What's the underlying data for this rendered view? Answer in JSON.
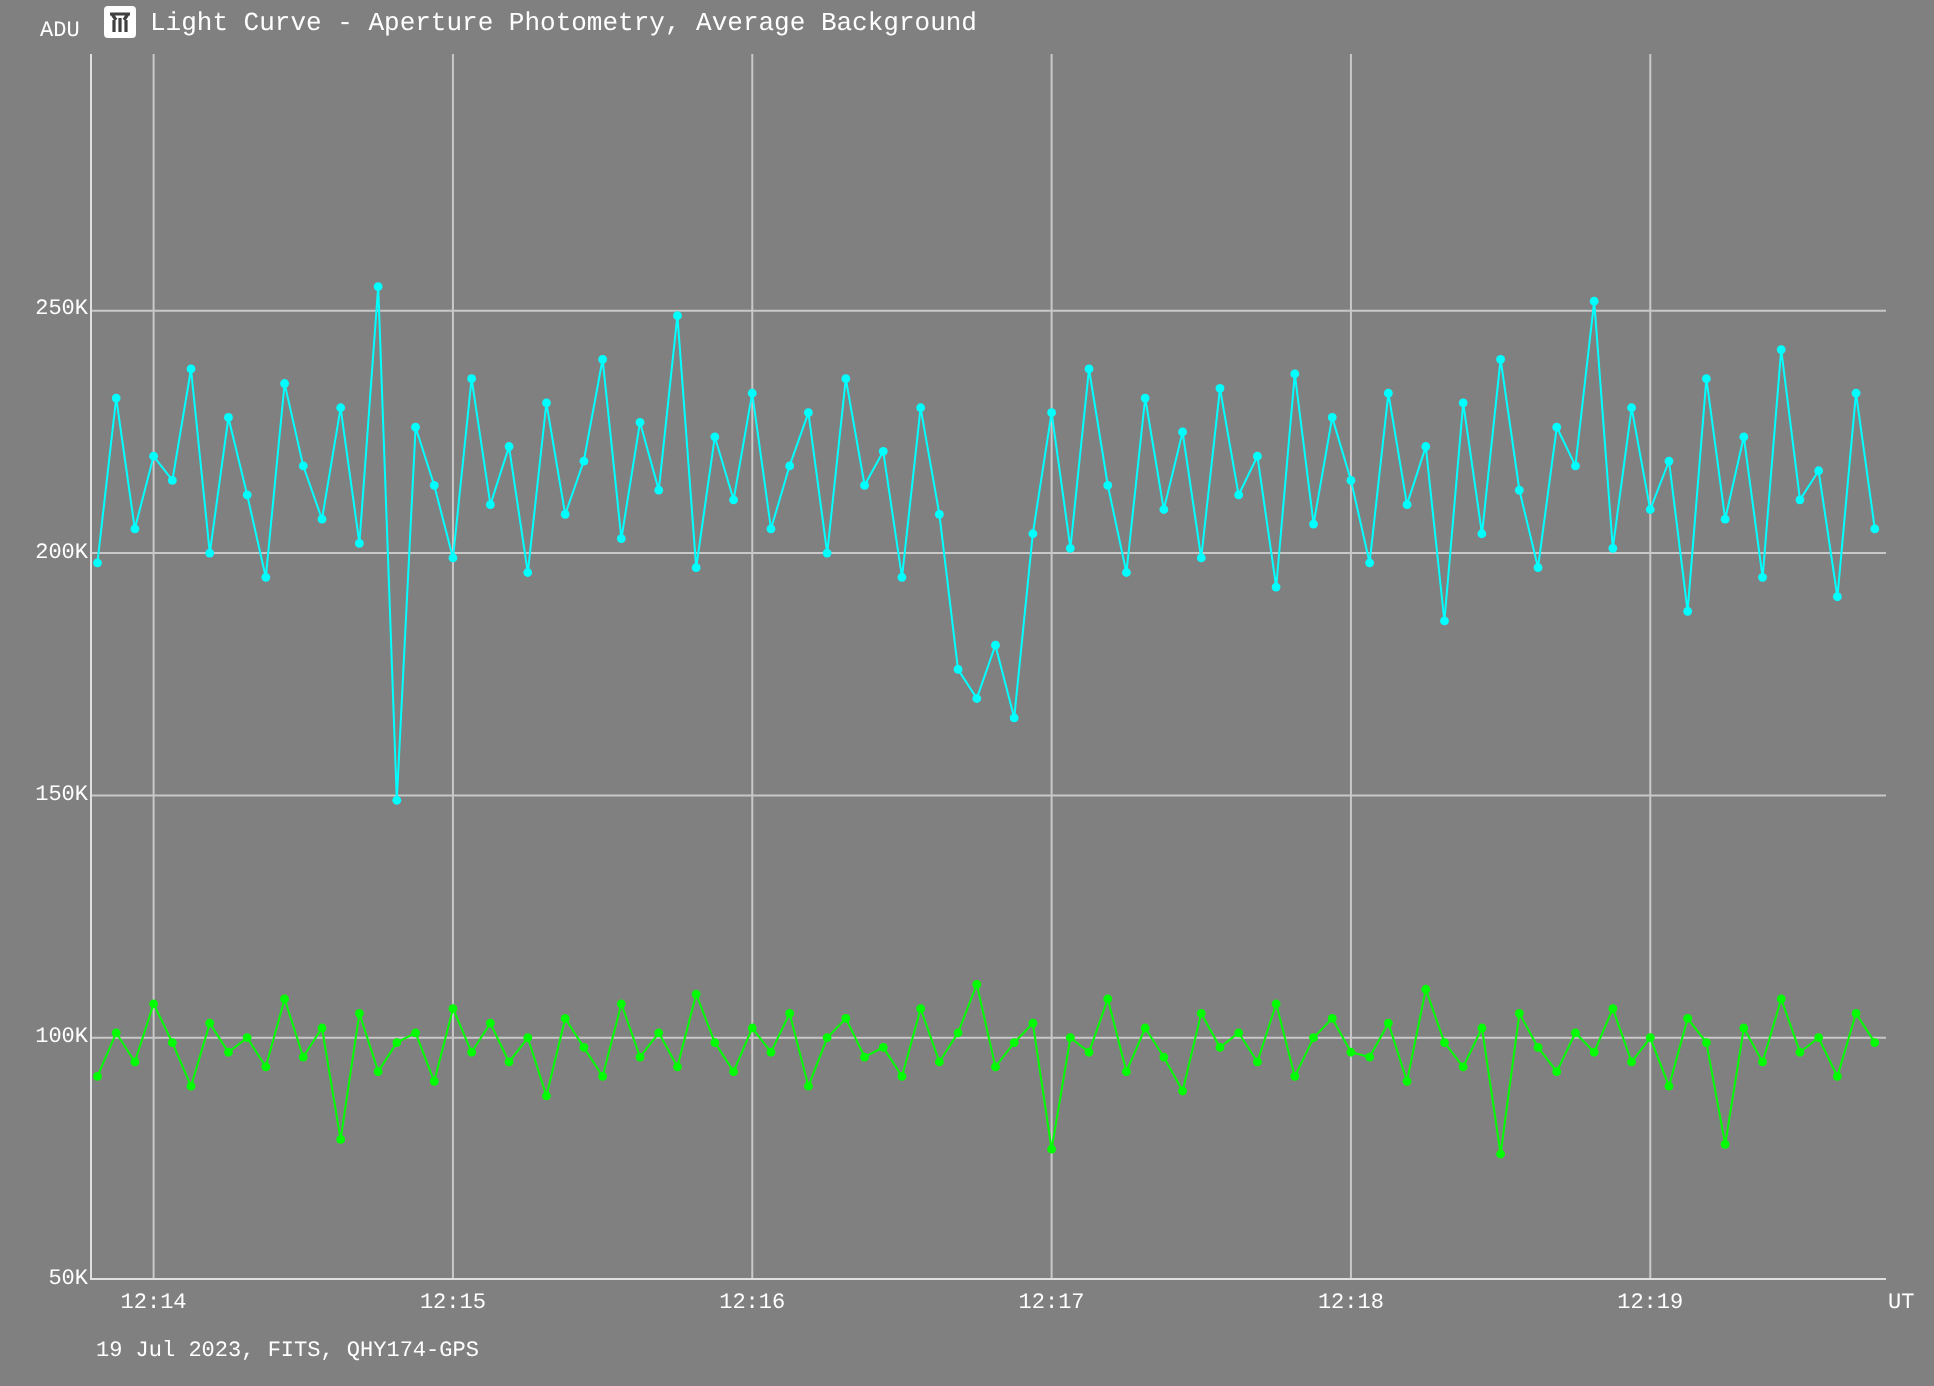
{
  "window": {
    "title": "Light Curve - Aperture Photometry, Average Background"
  },
  "chart": {
    "chart_data": {
      "type": "line",
      "grid": true,
      "ylabel": "ADU",
      "xlabel": "UT",
      "ylim": [
        50,
        303
      ],
      "yticks": [
        {
          "value": 250,
          "label": "250K"
        },
        {
          "value": 200,
          "label": "200K"
        },
        {
          "value": 150,
          "label": "150K"
        },
        {
          "value": 100,
          "label": "100K"
        },
        {
          "value": 50,
          "label": "50K"
        }
      ],
      "categories": [
        null,
        null,
        null,
        "12:14",
        null,
        null,
        null,
        null,
        null,
        null,
        null,
        null,
        null,
        null,
        null,
        null,
        null,
        null,
        null,
        "12:15",
        null,
        null,
        null,
        null,
        null,
        null,
        null,
        null,
        null,
        null,
        null,
        null,
        null,
        null,
        null,
        "12:16",
        null,
        null,
        null,
        null,
        null,
        null,
        null,
        null,
        null,
        null,
        null,
        null,
        null,
        null,
        null,
        "12:17",
        null,
        null,
        null,
        null,
        null,
        null,
        null,
        null,
        null,
        null,
        null,
        null,
        null,
        null,
        null,
        "12:18",
        null,
        null,
        null,
        null,
        null,
        null,
        null,
        null,
        null,
        null,
        null,
        null,
        null,
        null,
        null,
        "12:19",
        null,
        null,
        null,
        null,
        null,
        null,
        null,
        null,
        null,
        null,
        null,
        null
      ],
      "series": [
        {
          "color": "#00ffff",
          "marker": "circle",
          "values": [
            198,
            232,
            205,
            220,
            215,
            238,
            200,
            228,
            212,
            195,
            235,
            218,
            207,
            230,
            202,
            255,
            149,
            226,
            214,
            199,
            236,
            210,
            222,
            196,
            231,
            208,
            219,
            240,
            203,
            227,
            213,
            249,
            197,
            224,
            211,
            233,
            205,
            218,
            229,
            200,
            236,
            214,
            221,
            195,
            230,
            208,
            176,
            170,
            181,
            166,
            204,
            229,
            201,
            238,
            214,
            196,
            232,
            209,
            225,
            199,
            234,
            212,
            220,
            193,
            237,
            206,
            228,
            215,
            198,
            233,
            210,
            222,
            186,
            231,
            204,
            240,
            213,
            197,
            226,
            218,
            252,
            201,
            230,
            209,
            219,
            188,
            236,
            207,
            224,
            195,
            242,
            211,
            217,
            191,
            233,
            205
          ]
        },
        {
          "color": "#00ff00",
          "marker": "circle",
          "values": [
            92,
            101,
            95,
            107,
            99,
            90,
            103,
            97,
            100,
            94,
            108,
            96,
            102,
            79,
            105,
            93,
            99,
            101,
            91,
            106,
            97,
            103,
            95,
            100,
            88,
            104,
            98,
            92,
            107,
            96,
            101,
            94,
            109,
            99,
            93,
            102,
            97,
            105,
            90,
            100,
            104,
            96,
            98,
            92,
            106,
            95,
            101,
            111,
            94,
            99,
            103,
            77,
            100,
            97,
            108,
            93,
            102,
            96,
            89,
            105,
            98,
            101,
            95,
            107,
            92,
            100,
            104,
            97,
            96,
            103,
            91,
            110,
            99,
            94,
            102,
            76,
            105,
            98,
            93,
            101,
            97,
            106,
            95,
            100,
            90,
            104,
            99,
            78,
            102,
            95,
            108,
            97,
            100,
            92,
            105,
            99
          ]
        }
      ]
    }
  },
  "footer": "19 Jul 2023, FITS, QHY174-GPS"
}
